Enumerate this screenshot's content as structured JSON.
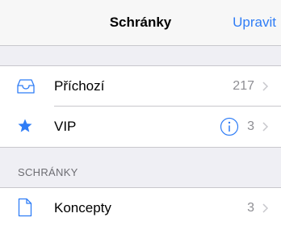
{
  "navbar": {
    "title": "Schránky",
    "edit_label": "Upravit"
  },
  "mailboxes": [
    {
      "label": "Příchozí",
      "count": "217",
      "icon": "inbox-tray-icon"
    },
    {
      "label": "VIP",
      "count": "3",
      "icon": "star-icon",
      "info_icon": "info-icon"
    }
  ],
  "section": {
    "header": "SCHRÁNKY"
  },
  "folders": [
    {
      "label": "Koncepty",
      "count": "3",
      "icon": "document-icon"
    }
  ],
  "colors": {
    "accent": "#2f7df6",
    "background": "#efeff4",
    "separator": "#c8c7cc",
    "secondary_text": "#8e8e93"
  }
}
